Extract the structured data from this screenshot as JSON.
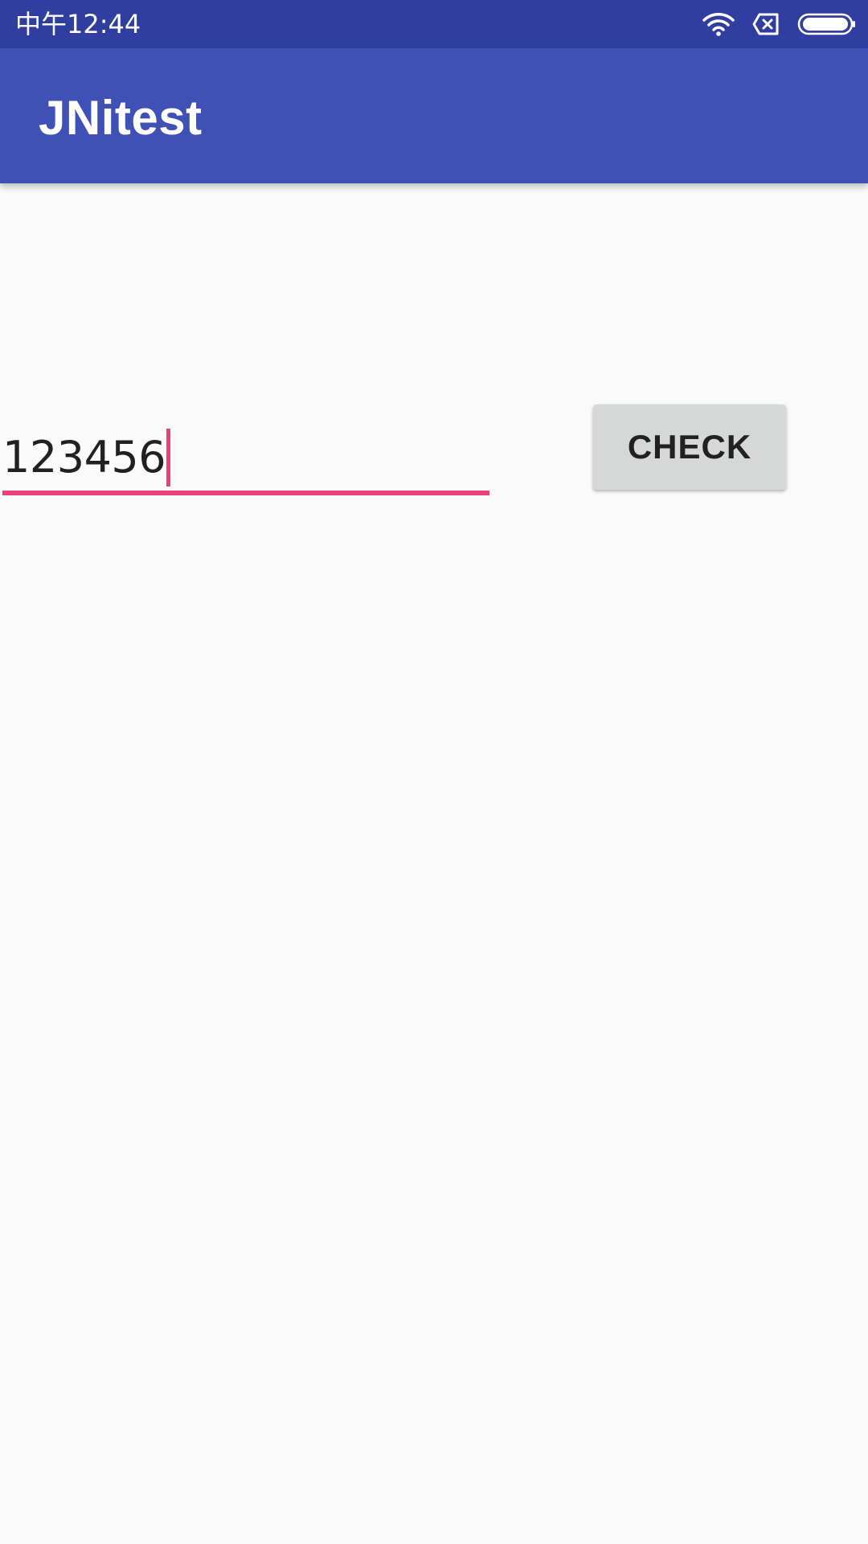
{
  "status_bar": {
    "time": "中午12:44",
    "icons": [
      "wifi-icon",
      "sim-absent-icon",
      "battery-icon"
    ],
    "background_color": "#303f9f"
  },
  "app_bar": {
    "title": "JNitest",
    "background_color": "#3f51b5"
  },
  "main": {
    "input": {
      "value": "123456",
      "accent_color": "#ec407a"
    },
    "check_button": {
      "label": "CHECK"
    }
  }
}
